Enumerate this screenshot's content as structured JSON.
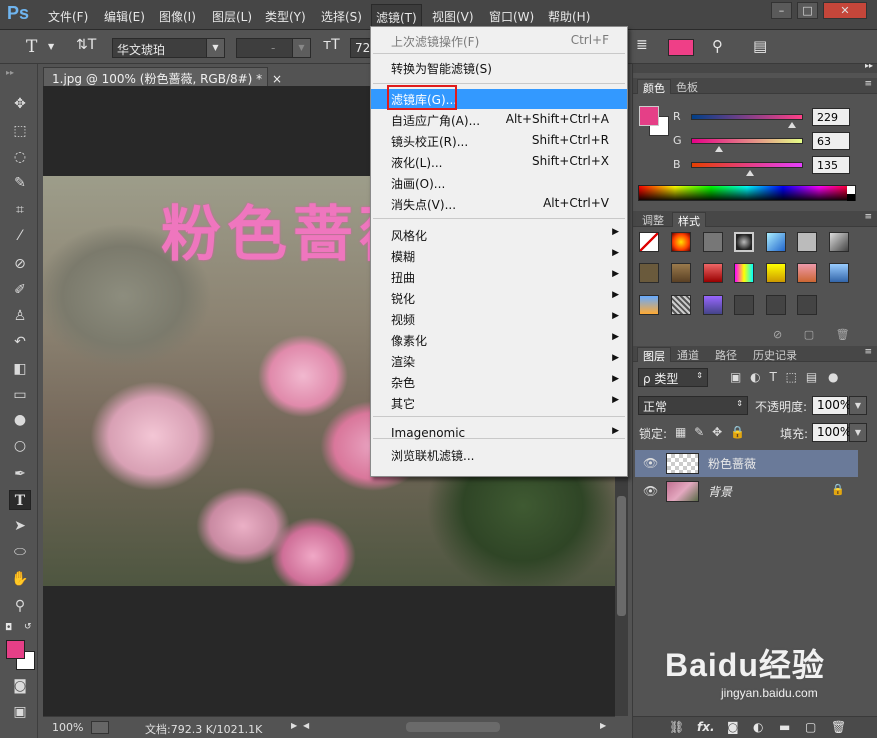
{
  "app": {
    "logo": "Ps"
  },
  "menubar": {
    "items": [
      "文件(F)",
      "编辑(E)",
      "图像(I)",
      "图层(L)",
      "类型(Y)",
      "选择(S)",
      "滤镜(T)",
      "视图(V)",
      "窗口(W)",
      "帮助(H)"
    ],
    "window_buttons": [
      "–",
      "□",
      "✕"
    ]
  },
  "options": {
    "font_family": "华文琥珀",
    "font_style": "-",
    "font_size": "72",
    "color_hex": "#ef3f87",
    "tool_icon": "T"
  },
  "document": {
    "tab_title": "1.jpg @ 100% (粉色蔷薇, RGB/8#) *",
    "canvas_text": "粉色蔷薇",
    "zoom": "100%",
    "doc_info": "文档:792.3 K/1021.1K"
  },
  "filter_menu": {
    "items": [
      {
        "label": "上次滤镜操作(F)",
        "shortcut": "Ctrl+F",
        "disabled": true
      },
      {
        "label": "转换为智能滤镜(S)",
        "shortcut": ""
      },
      {
        "label": "滤镜库(G)...",
        "shortcut": "",
        "highlighted": true
      },
      {
        "label": "自适应广角(A)...",
        "shortcut": "Alt+Shift+Ctrl+A"
      },
      {
        "label": "镜头校正(R)...",
        "shortcut": "Shift+Ctrl+R"
      },
      {
        "label": "液化(L)...",
        "shortcut": "Shift+Ctrl+X"
      },
      {
        "label": "油画(O)...",
        "shortcut": ""
      },
      {
        "label": "消失点(V)...",
        "shortcut": "Alt+Ctrl+V"
      },
      {
        "label": "风格化",
        "submenu": true
      },
      {
        "label": "模糊",
        "submenu": true
      },
      {
        "label": "扭曲",
        "submenu": true
      },
      {
        "label": "锐化",
        "submenu": true
      },
      {
        "label": "视频",
        "submenu": true
      },
      {
        "label": "像素化",
        "submenu": true
      },
      {
        "label": "渲染",
        "submenu": true
      },
      {
        "label": "杂色",
        "submenu": true
      },
      {
        "label": "其它",
        "submenu": true
      },
      {
        "label": "Imagenomic",
        "submenu": true
      },
      {
        "label": "浏览联机滤镜..."
      }
    ]
  },
  "color_panel": {
    "tabs": [
      "颜色",
      "色板"
    ],
    "r": {
      "label": "R",
      "value": "229"
    },
    "g": {
      "label": "G",
      "value": "63"
    },
    "b": {
      "label": "B",
      "value": "135"
    },
    "foreground_hex": "#e53f87",
    "background_hex": "#ffffff"
  },
  "styles_panel": {
    "tabs": [
      "调整",
      "样式"
    ]
  },
  "layers_panel": {
    "tabs": [
      "图层",
      "通道",
      "路径",
      "历史记录"
    ],
    "filter_kind": "ρ 类型",
    "blend_mode": "正常",
    "opacity_label": "不透明度:",
    "opacity_value": "100%",
    "lock_label": "锁定:",
    "fill_label": "填充:",
    "fill_value": "100%",
    "layers": [
      {
        "name": "粉色蔷薇",
        "selected": true
      },
      {
        "name": "背景",
        "locked": true
      }
    ],
    "footer_icons": [
      "link-icon",
      "fx-icon",
      "mask-icon",
      "adjustment-icon",
      "group-icon",
      "new-layer-icon",
      "trash-icon"
    ],
    "footer_fx": "fx."
  },
  "watermark": {
    "brand": "Baidu经验",
    "url": "jingyan.baidu.com"
  }
}
